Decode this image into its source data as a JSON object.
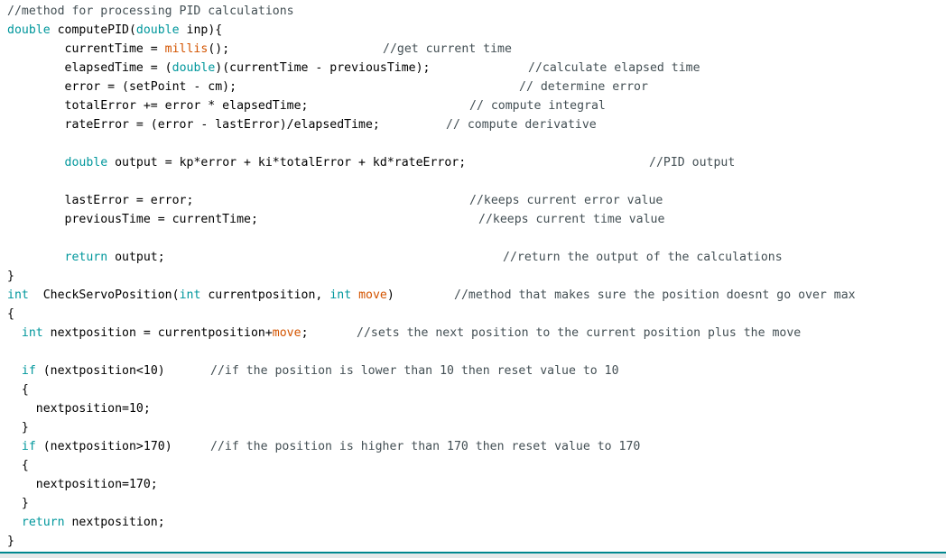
{
  "colors": {
    "keyword": "#00979c",
    "function": "#d35400",
    "comment": "#434f54",
    "text": "#000000",
    "accent": "#00878f"
  },
  "code": {
    "lines": [
      {
        "tokens": [
          {
            "t": "cm",
            "v": "//method for processing PID calculations"
          }
        ]
      },
      {
        "tokens": [
          {
            "t": "kw",
            "v": "double"
          },
          {
            "t": "plain",
            "v": " computePID("
          },
          {
            "t": "kw",
            "v": "double"
          },
          {
            "t": "plain",
            "v": " inp){"
          }
        ]
      },
      {
        "tokens": [
          {
            "t": "plain",
            "v": "        currentTime = "
          },
          {
            "t": "fn",
            "v": "millis"
          },
          {
            "t": "plain",
            "v": "();"
          }
        ],
        "comment": "//get current time",
        "col": 424
      },
      {
        "tokens": [
          {
            "t": "plain",
            "v": "        elapsedTime = ("
          },
          {
            "t": "kw",
            "v": "double"
          },
          {
            "t": "plain",
            "v": ")(currentTime - previousTime);"
          }
        ],
        "comment": "//calculate elapsed time",
        "col": 585
      },
      {
        "tokens": [
          {
            "t": "plain",
            "v": "        error = (setPoint - cm);"
          }
        ],
        "comment": "// determine error",
        "col": 575
      },
      {
        "tokens": [
          {
            "t": "plain",
            "v": "        totalError += error * elapsedTime;"
          }
        ],
        "comment": "// compute integral",
        "col": 520
      },
      {
        "tokens": [
          {
            "t": "plain",
            "v": "        rateError = (error - lastError)/elapsedTime;"
          }
        ],
        "comment": "// compute derivative",
        "col": 494
      },
      {
        "tokens": []
      },
      {
        "tokens": [
          {
            "t": "plain",
            "v": "        "
          },
          {
            "t": "kw",
            "v": "double"
          },
          {
            "t": "plain",
            "v": " output = kp*error + ki*totalError + kd*rateError;"
          }
        ],
        "comment": "//PID output",
        "col": 719
      },
      {
        "tokens": []
      },
      {
        "tokens": [
          {
            "t": "plain",
            "v": "        lastError = error;"
          }
        ],
        "comment": "//keeps current error value",
        "col": 520
      },
      {
        "tokens": [
          {
            "t": "plain",
            "v": "        previousTime = currentTime;"
          }
        ],
        "comment": "//keeps current time value",
        "col": 530
      },
      {
        "tokens": []
      },
      {
        "tokens": [
          {
            "t": "plain",
            "v": "        "
          },
          {
            "t": "kw",
            "v": "return"
          },
          {
            "t": "plain",
            "v": " output;"
          }
        ],
        "comment": "//return the output of the calculations",
        "col": 557
      },
      {
        "tokens": [
          {
            "t": "plain",
            "v": "}"
          }
        ]
      },
      {
        "tokens": [
          {
            "t": "kw",
            "v": "int"
          },
          {
            "t": "plain",
            "v": "  CheckServoPosition("
          },
          {
            "t": "kw",
            "v": "int"
          },
          {
            "t": "plain",
            "v": " currentposition, "
          },
          {
            "t": "kw",
            "v": "int"
          },
          {
            "t": "plain",
            "v": " "
          },
          {
            "t": "fn",
            "v": "move"
          },
          {
            "t": "plain",
            "v": ")"
          }
        ],
        "comment": "//method that makes sure the position doesnt go over max",
        "col": 503
      },
      {
        "tokens": [
          {
            "t": "plain",
            "v": "{"
          }
        ]
      },
      {
        "tokens": [
          {
            "t": "plain",
            "v": "  "
          },
          {
            "t": "kw",
            "v": "int"
          },
          {
            "t": "plain",
            "v": " nextposition = currentposition+"
          },
          {
            "t": "fn",
            "v": "move"
          },
          {
            "t": "plain",
            "v": ";"
          }
        ],
        "comment": "//sets the next position to the current position plus the move",
        "col": 395
      },
      {
        "tokens": []
      },
      {
        "tokens": [
          {
            "t": "plain",
            "v": "  "
          },
          {
            "t": "kw",
            "v": "if"
          },
          {
            "t": "plain",
            "v": " (nextposition<10)"
          }
        ],
        "comment": "//if the position is lower than 10 then reset value to 10",
        "col": 233
      },
      {
        "tokens": [
          {
            "t": "plain",
            "v": "  {"
          }
        ]
      },
      {
        "tokens": [
          {
            "t": "plain",
            "v": "    nextposition=10;"
          }
        ]
      },
      {
        "tokens": [
          {
            "t": "plain",
            "v": "  }"
          }
        ]
      },
      {
        "tokens": [
          {
            "t": "plain",
            "v": "  "
          },
          {
            "t": "kw",
            "v": "if"
          },
          {
            "t": "plain",
            "v": " (nextposition>170)"
          }
        ],
        "comment": "//if the position is higher than 170 then reset value to 170",
        "col": 233
      },
      {
        "tokens": [
          {
            "t": "plain",
            "v": "  {"
          }
        ]
      },
      {
        "tokens": [
          {
            "t": "plain",
            "v": "    nextposition=170;"
          }
        ]
      },
      {
        "tokens": [
          {
            "t": "plain",
            "v": "  }"
          }
        ]
      },
      {
        "tokens": [
          {
            "t": "plain",
            "v": "  "
          },
          {
            "t": "kw",
            "v": "return"
          },
          {
            "t": "plain",
            "v": " nextposition;"
          }
        ]
      },
      {
        "tokens": [
          {
            "t": "plain",
            "v": "}"
          }
        ]
      }
    ]
  }
}
